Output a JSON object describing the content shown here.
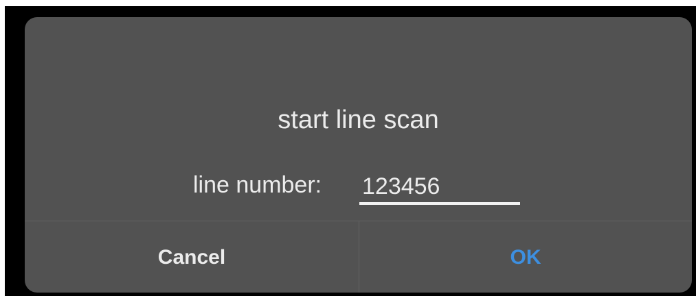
{
  "dialog": {
    "title": "start line scan",
    "field_label": "line number:",
    "field_value": "123456",
    "cancel_label": "Cancel",
    "ok_label": "OK"
  },
  "colors": {
    "dialog_background": "#525252",
    "text": "#ececec",
    "accent": "#3d8fe0",
    "backdrop": "#000000"
  }
}
